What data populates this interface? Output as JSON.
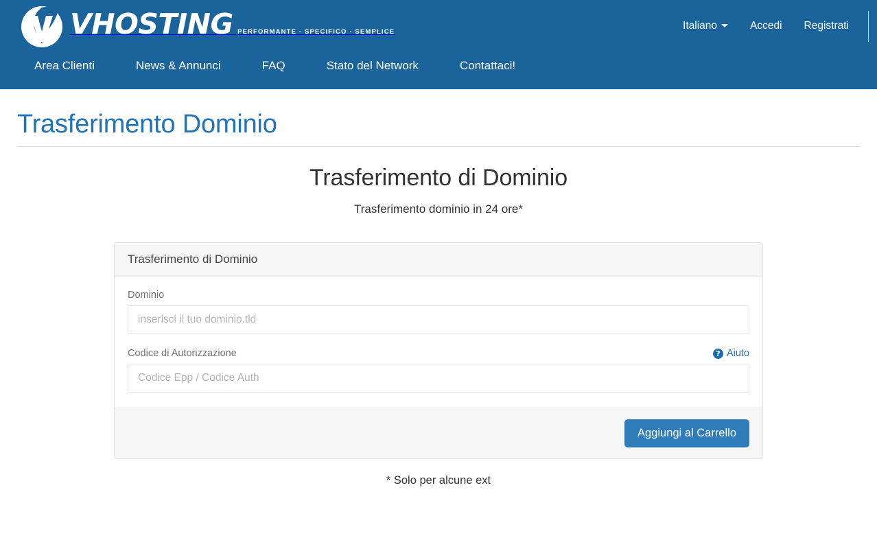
{
  "header": {
    "logo": {
      "wordmark": "VHOSTING",
      "tagline": "PERFORMANTE · SPECIFICO · SEMPLICE"
    },
    "top_links": [
      {
        "label": "Italiano",
        "has_caret": true
      },
      {
        "label": "Accedi",
        "has_caret": false
      },
      {
        "label": "Registrati",
        "has_caret": false
      }
    ],
    "nav_items": [
      {
        "label": "Area Clienti"
      },
      {
        "label": "News & Annunci"
      },
      {
        "label": "FAQ"
      },
      {
        "label": "Stato del Network"
      },
      {
        "label": "Contattaci!"
      }
    ],
    "colors": {
      "header_bg": "#1a649b",
      "text": "#ffffff"
    }
  },
  "page": {
    "title": "Trasferimento Dominio",
    "title_color": "#2275b5",
    "heading": "Trasferimento di Dominio",
    "subheading": "Trasferimento dominio in 24 ore*",
    "footnote": "* Solo per alcune ext"
  },
  "card": {
    "header_title": "Trasferimento di Dominio",
    "fields": [
      {
        "label": "Dominio",
        "placeholder": "inserisci il tuo dominio.tld",
        "value": ""
      },
      {
        "label": "Codice di Autorizzazione",
        "placeholder": "Codice Epp / Codice Auth",
        "value": ""
      }
    ],
    "help": {
      "label": "Aiuto",
      "icon": "question-circle-icon",
      "color": "#2275b5"
    },
    "submit_label": "Aggiungi al Carrello",
    "submit_color": "#2f7cba"
  }
}
